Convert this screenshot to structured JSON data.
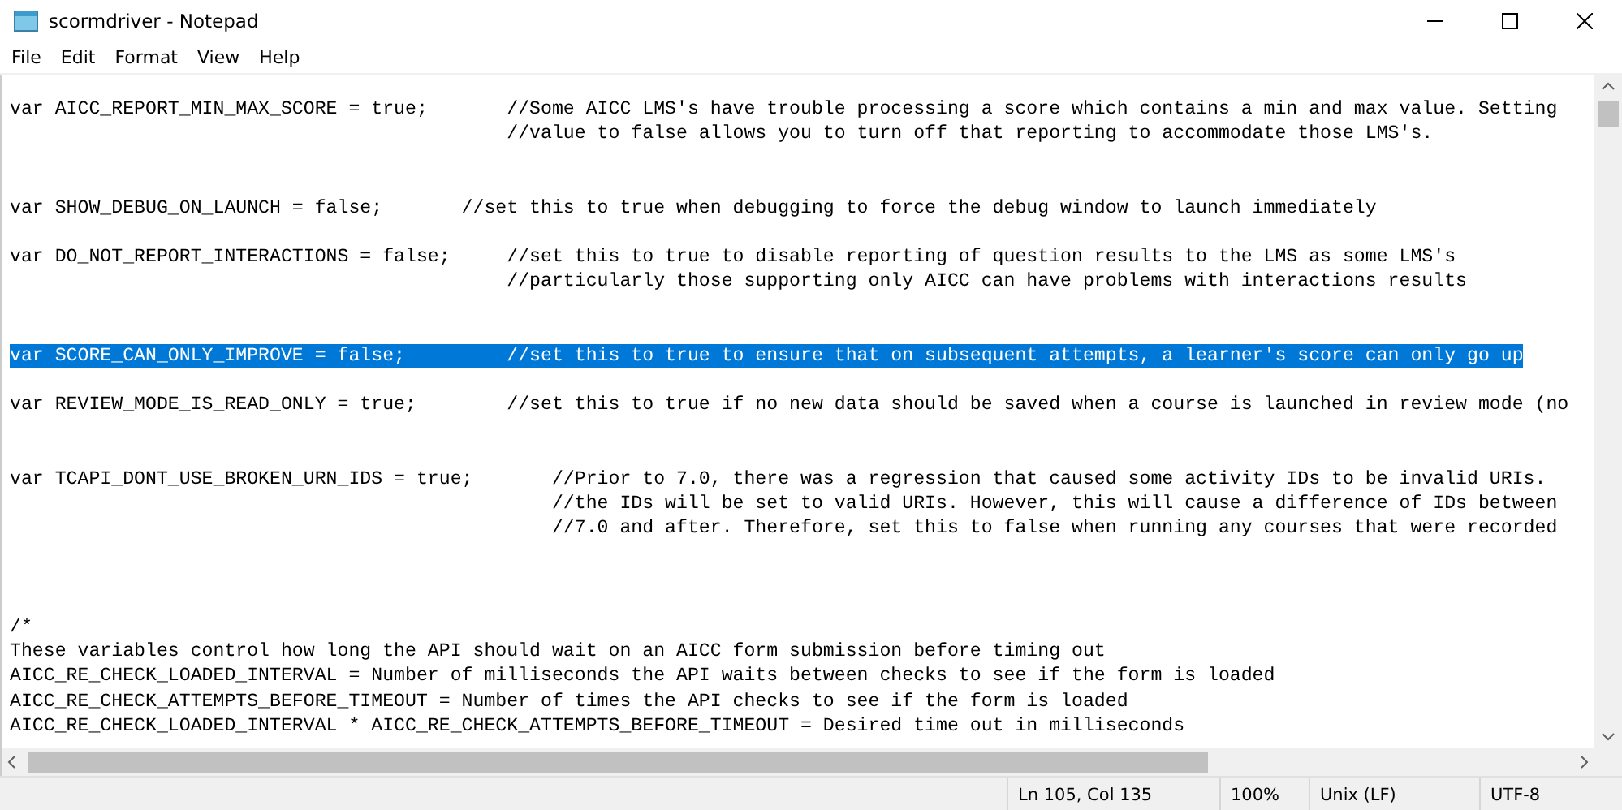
{
  "window": {
    "title": "scormdriver - Notepad"
  },
  "menu": [
    "File",
    "Edit",
    "Format",
    "View",
    "Help"
  ],
  "editor": {
    "lines": [
      {
        "kind": "code",
        "text": "var AICC_REPORT_MIN_MAX_SCORE = true;       //Some AICC LMS's have trouble processing a score which contains a min and max value. Setting",
        "selected": false
      },
      {
        "kind": "code",
        "text": "                                            //value to false allows you to turn off that reporting to accommodate those LMS's.",
        "selected": false
      },
      {
        "kind": "blank"
      },
      {
        "kind": "blank"
      },
      {
        "kind": "code",
        "text": "var SHOW_DEBUG_ON_LAUNCH = false;       //set this to true when debugging to force the debug window to launch immediately",
        "selected": false
      },
      {
        "kind": "blank"
      },
      {
        "kind": "code",
        "text": "var DO_NOT_REPORT_INTERACTIONS = false;     //set this to true to disable reporting of question results to the LMS as some LMS's",
        "selected": false
      },
      {
        "kind": "code",
        "text": "                                            //particularly those supporting only AICC can have problems with interactions results",
        "selected": false
      },
      {
        "kind": "blank"
      },
      {
        "kind": "blank"
      },
      {
        "kind": "code",
        "text": "var SCORE_CAN_ONLY_IMPROVE = false;         //set this to true to ensure that on subsequent attempts, a learner's score can only go up",
        "selected": true
      },
      {
        "kind": "blank"
      },
      {
        "kind": "code",
        "text": "var REVIEW_MODE_IS_READ_ONLY = true;        //set this to true if no new data should be saved when a course is launched in review mode (no",
        "selected": false
      },
      {
        "kind": "blank"
      },
      {
        "kind": "blank"
      },
      {
        "kind": "code",
        "text": "var TCAPI_DONT_USE_BROKEN_URN_IDS = true;       //Prior to 7.0, there was a regression that caused some activity IDs to be invalid URIs.",
        "selected": false
      },
      {
        "kind": "code",
        "text": "                                                //the IDs will be set to valid URIs. However, this will cause a difference of IDs between",
        "selected": false
      },
      {
        "kind": "code",
        "text": "                                                //7.0 and after. Therefore, set this to false when running any courses that were recorded",
        "selected": false
      },
      {
        "kind": "blank"
      },
      {
        "kind": "blank"
      },
      {
        "kind": "blank"
      },
      {
        "kind": "code",
        "text": "/*",
        "selected": false
      },
      {
        "kind": "code",
        "text": "These variables control how long the API should wait on an AICC form submission before timing out",
        "selected": false
      },
      {
        "kind": "code",
        "text": "AICC_RE_CHECK_LOADED_INTERVAL = Number of milliseconds the API waits between checks to see if the form is loaded",
        "selected": false
      },
      {
        "kind": "code",
        "text": "AICC_RE_CHECK_ATTEMPTS_BEFORE_TIMEOUT = Number of times the API checks to see if the form is loaded",
        "selected": false
      },
      {
        "kind": "code",
        "text": "AICC_RE_CHECK_LOADED_INTERVAL * AICC_RE_CHECK_ATTEMPTS_BEFORE_TIMEOUT = Desired time out in milliseconds",
        "selected": false
      }
    ]
  },
  "status_bar": [
    "Ln 105, Col 135",
    "100%",
    "Unix (LF)",
    "UTF-8"
  ]
}
